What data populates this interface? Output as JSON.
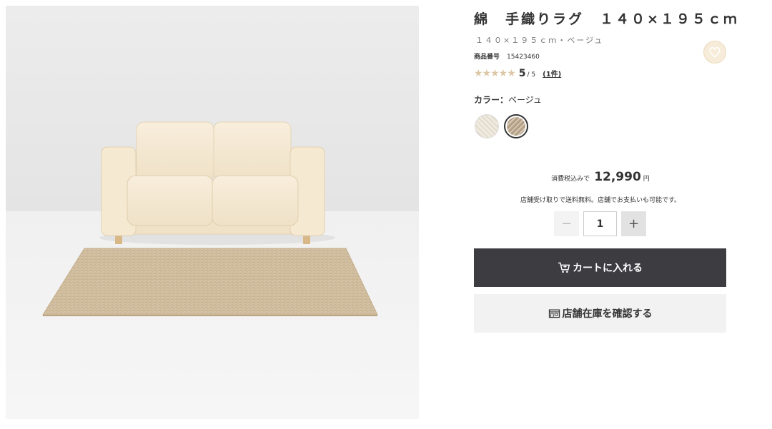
{
  "product": {
    "title": "綿　手織りラグ　１４０×１９５ｃｍ",
    "subtitle": "１４０×１９５ｃｍ・ベージュ",
    "number_label": "商品番号",
    "number_value": "15423460",
    "rating": {
      "stars": "★★★★★",
      "score": "5",
      "out_of": "/ 5",
      "review_count": "(1件)"
    },
    "color_label": "カラー：",
    "color_value": "ベージュ",
    "swatches": [
      {
        "name": "off-white",
        "selected": false,
        "color": "#ece6da"
      },
      {
        "name": "beige",
        "selected": true,
        "color": "#c2b097"
      }
    ]
  },
  "price": {
    "label": "消費税込みで",
    "amount": "12,990",
    "currency": "円",
    "note": "店舗受け取りで送料無料。店舗でお支払いも可能です。"
  },
  "quantity": {
    "minus": "−",
    "value": "1",
    "plus": "+"
  },
  "actions": {
    "cart_label": "カートに入れる",
    "store_label": "店舗在庫を確認する"
  },
  "colors": {
    "cart_bg": "#3c3c41",
    "store_bg": "#f2f2f2",
    "star": "#dcc8a6",
    "favorite_bg": "#f6ecd9"
  },
  "icons": [
    "heart-icon",
    "cart-icon",
    "store-icon",
    "star-icon"
  ]
}
